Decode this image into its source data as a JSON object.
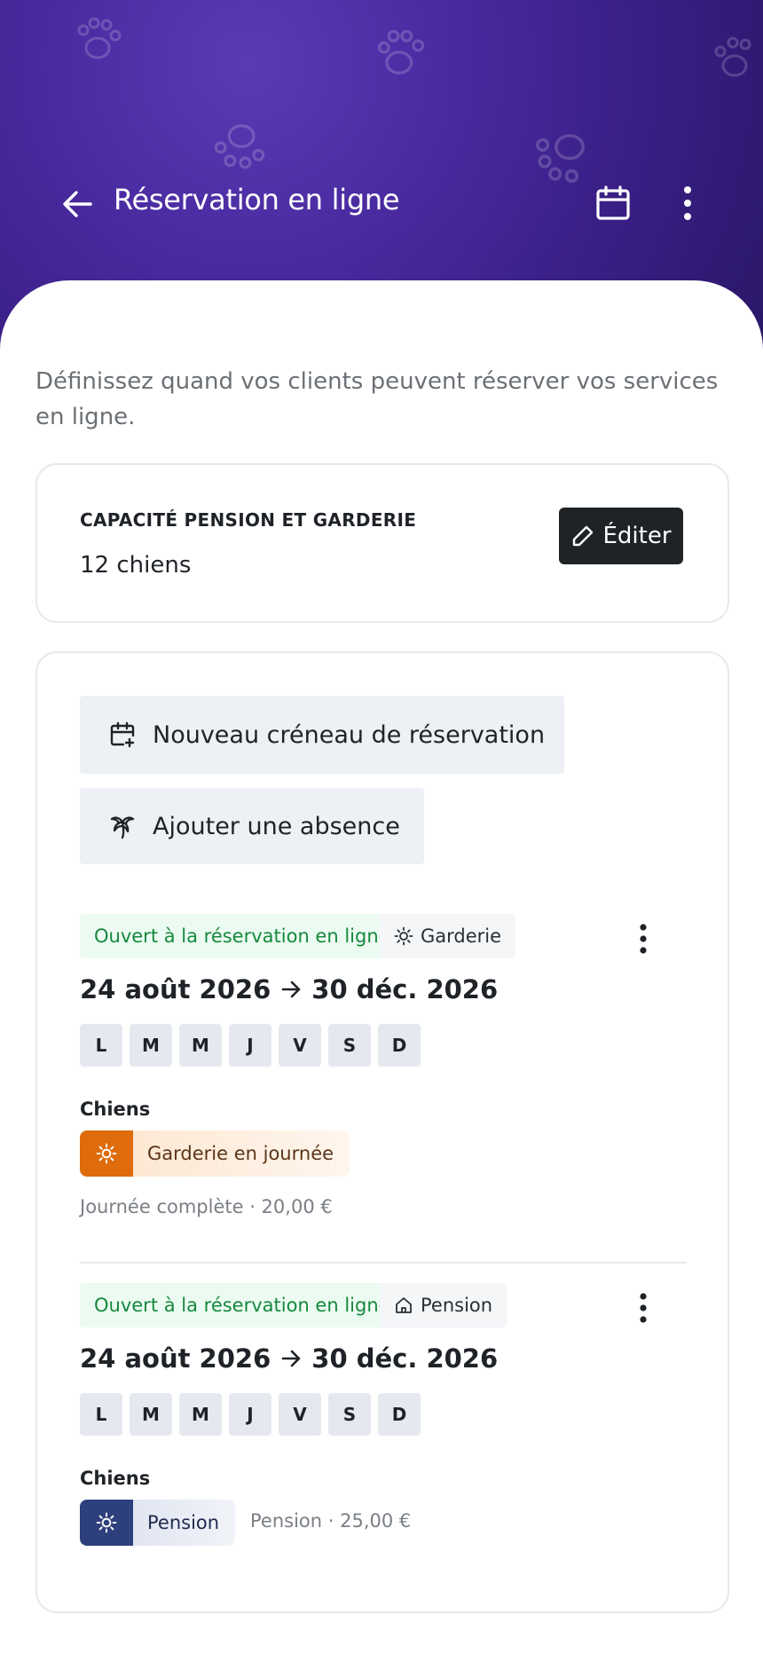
{
  "header": {
    "title": "Réservation en ligne",
    "back_icon": "arrow-left-icon",
    "calendar_icon": "calendar-icon",
    "more_icon": "more-vertical-icon"
  },
  "intro": "Définissez quand vos clients peuvent réserver vos services en ligne.",
  "capacity": {
    "label": "CAPACITÉ PENSION ET GARDERIE",
    "value": "12 chiens",
    "edit_label": "Éditer"
  },
  "actions": {
    "new_slot": "Nouveau créneau de réservation",
    "add_absence": "Ajouter une absence"
  },
  "slots": [
    {
      "status": "Ouvert à la réservation en ligne",
      "type": "Garderie",
      "type_icon": "sun-icon",
      "start": "24 août 2026",
      "end": "30 déc. 2026",
      "days": [
        "L",
        "M",
        "M",
        "J",
        "V",
        "S",
        "D"
      ],
      "animals": "Chiens",
      "service": "Garderie en journée",
      "service_color": "#de6c0c",
      "price": "Journée complète · 20,00 €"
    },
    {
      "status": "Ouvert à la réservation en ligne",
      "type": "Pension",
      "type_icon": "home-icon",
      "start": "24 août 2026",
      "end": "30 déc. 2026",
      "days": [
        "L",
        "M",
        "M",
        "J",
        "V",
        "S",
        "D"
      ],
      "animals": "Chiens",
      "service": "Pension",
      "service_color": "#2e3f7d",
      "price": "Pension · 25,00 €"
    }
  ],
  "colors": {
    "header_bg": "#4a2a9f",
    "status_text": "#16883e",
    "status_bg": "#ecfbf1"
  }
}
